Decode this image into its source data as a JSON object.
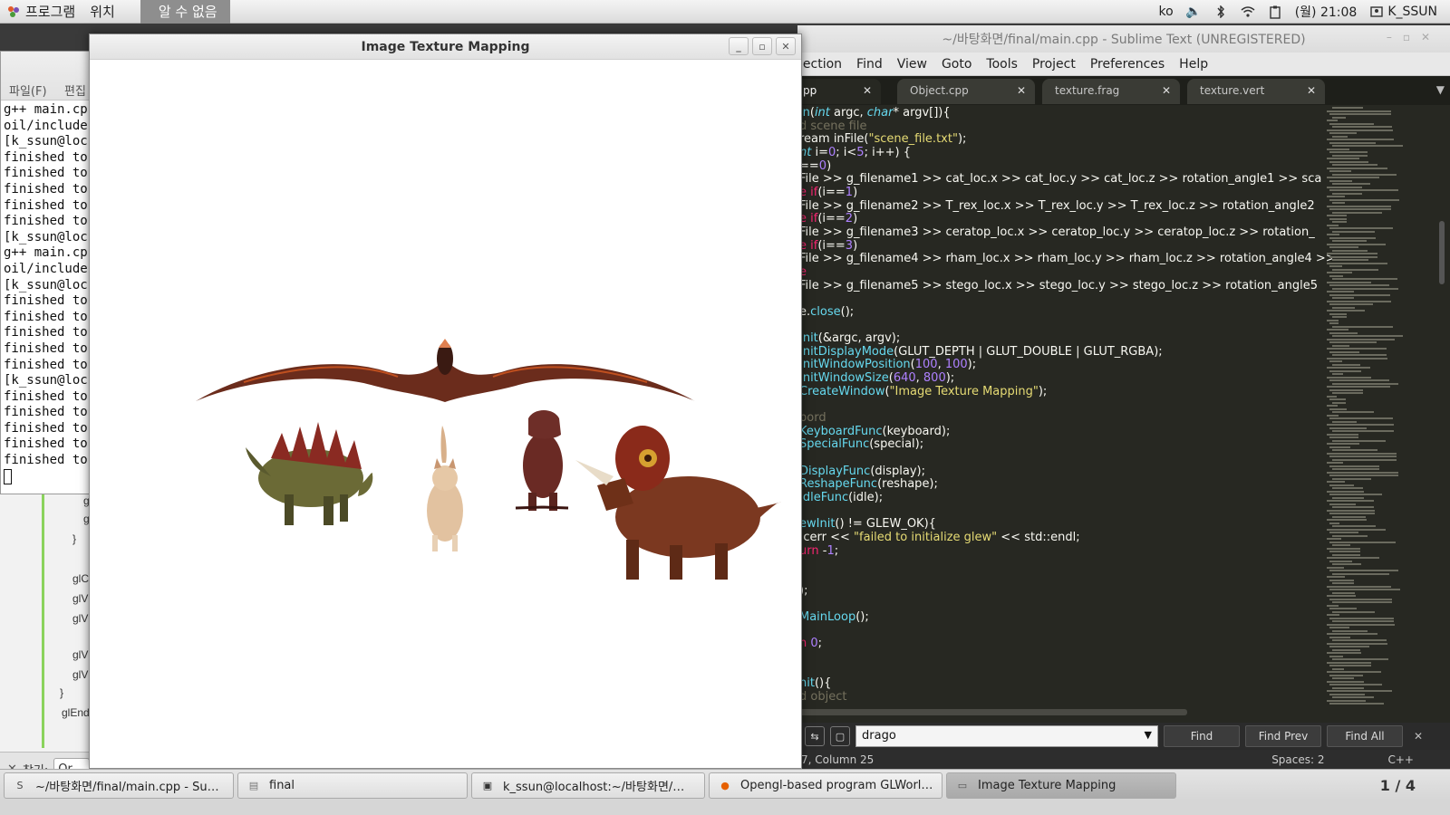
{
  "topbar": {
    "apps_menu": "프로그램",
    "places_menu": "위치",
    "active_app": "알 수 없음",
    "keyboard_layout": "ko",
    "clock": "(월) 21:08",
    "user": "K_SSUN"
  },
  "terminal": {
    "menu_file": "파일(F)",
    "menu_edit": "편집",
    "lines": [
      "g++ main.cp",
      "oil/include",
      "[k_ssun@loc",
      "finished to",
      "finished to",
      "finished to",
      "finished to",
      "finished to",
      "[k_ssun@loc",
      "g++ main.cp",
      "oil/include",
      "[k_ssun@loc",
      "finished to",
      "finished to",
      "finished to",
      "finished to",
      "finished to",
      "[k_ssun@loc",
      "finished to",
      "finished to",
      "finished to",
      "finished to",
      "finished to"
    ]
  },
  "gedit": {
    "lines": [
      "g",
      "g",
      "}",
      "glC",
      "glV",
      "glV",
      "glV",
      "glV",
      "}",
      "glEnd"
    ],
    "find_label": "찾기:",
    "find_value": "Or"
  },
  "glut": {
    "title": "Image Texture Mapping",
    "btn_minimize": "_",
    "btn_maximize": "▫",
    "btn_close": "✕"
  },
  "sublime": {
    "title": "~/바탕화면/final/main.cpp - Sublime Text (UNREGISTERED)",
    "menu": [
      "lection",
      "Find",
      "View",
      "Goto",
      "Tools",
      "Project",
      "Preferences",
      "Help"
    ],
    "tabs": [
      {
        "label": "pp",
        "active": true
      },
      {
        "label": "Object.cpp",
        "active": false
      },
      {
        "label": "texture.frag",
        "active": false
      },
      {
        "label": "texture.vert",
        "active": false
      }
    ],
    "find_value": "drago",
    "find_btn": "Find",
    "find_prev_btn": "Find Prev",
    "find_all_btn": "Find All",
    "status_position": "7, Column 25",
    "status_spaces": "Spaces: 2",
    "status_syntax": "C++"
  },
  "taskbar": {
    "items": [
      {
        "label": "~/바탕화면/final/main.cpp - Su…",
        "icon": "sublime-icon"
      },
      {
        "label": "final",
        "icon": "folder-icon"
      },
      {
        "label": "k_ssun@localhost:~/바탕화면/…",
        "icon": "terminal-icon"
      },
      {
        "label": "Opengl-based program GLWorl…",
        "icon": "firefox-icon"
      },
      {
        "label": "Image Texture Mapping",
        "icon": "window-icon"
      }
    ],
    "workspace": "1 / 4"
  },
  "colors": {
    "sublime_bg": "#272822",
    "keyword": "#66d9ef",
    "string": "#e6db74",
    "comment": "#75715e",
    "number": "#ae81ff"
  }
}
